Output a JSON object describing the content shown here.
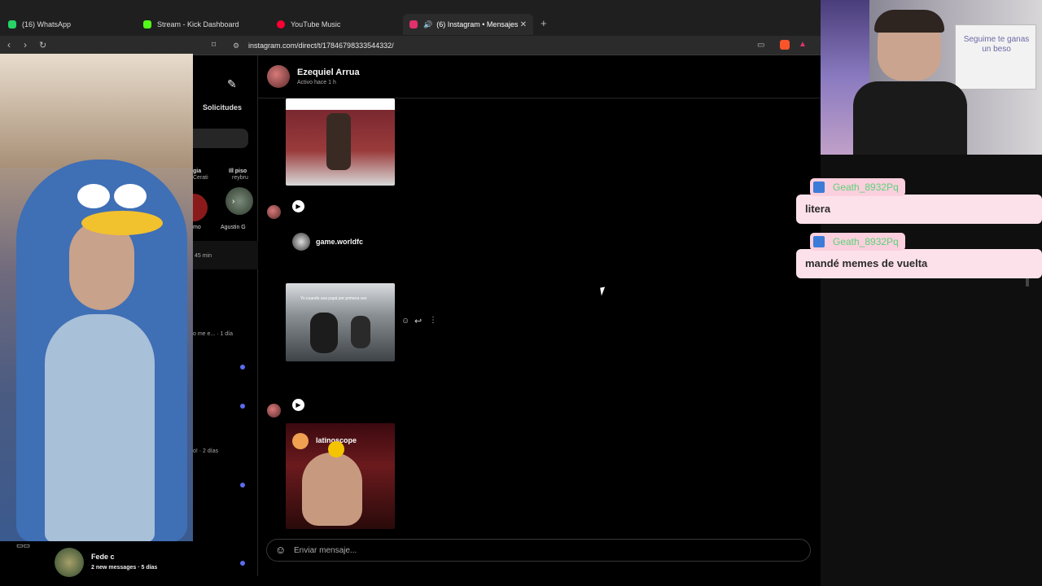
{
  "browser": {
    "tabs": [
      {
        "label": "(16) WhatsApp",
        "color": "#25d366"
      },
      {
        "label": "Stream - Kick Dashboard",
        "color": "#53fc18"
      },
      {
        "label": "YouTube Music",
        "color": "#ff0033"
      },
      {
        "label": "(6) Instagram • Mensajes",
        "color": "#e1306c"
      }
    ],
    "new_tab_symbol": "+",
    "url": "instagram.com/direct/t/17846798333544332/"
  },
  "sidebar": {
    "requests_label": "Solicitudes",
    "partial_names": [
      "gia",
      "Cerati",
      "Ill piso",
      "reybru",
      "mo",
      "Agustin G"
    ],
    "time_45": "45 min",
    "preview_1dia": "o me e... · 1 día",
    "preview_2dias": "o! · 2 días",
    "footer_name": "Fede c",
    "footer_status": "2 new messages · 5 días"
  },
  "chat": {
    "contact_name": "Ezequiel Arrua",
    "contact_status": "Activo hace 1 h",
    "shares": [
      {
        "account": "game.worldfc"
      },
      {
        "account": "latinoscope"
      }
    ],
    "video_caption": "Yo cuando sea papá por primera vez",
    "composer_placeholder": "Enviar mensaje..."
  },
  "stream_chat": {
    "messages": [
      {
        "user": "Geath_8932Pq",
        "text": "litera"
      },
      {
        "user": "Geath_8932Pq",
        "text": "mandé memes de vuelta"
      }
    ],
    "whiteboard_text": "Seguime te ganas un beso"
  },
  "colors": {
    "unread_dot": "#5b6cf0",
    "chat_bubble": "#fde1ea",
    "chat_username": "#5ad37a"
  }
}
